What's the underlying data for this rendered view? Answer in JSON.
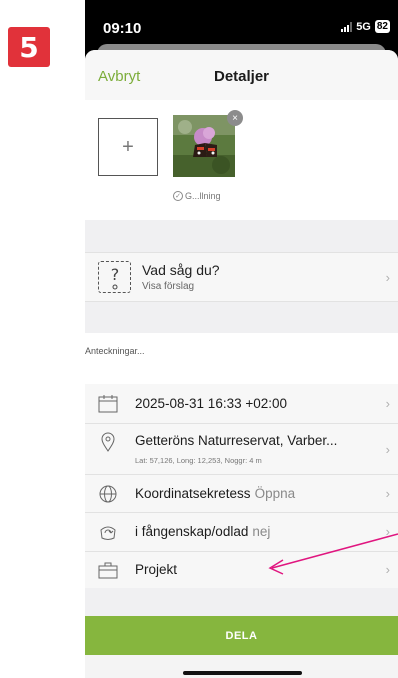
{
  "step_badge": "5",
  "status": {
    "time": "09:10",
    "network": "5G",
    "battery": "82"
  },
  "nav": {
    "cancel_label": "Avbryt",
    "title": "Detaljer"
  },
  "photos": {
    "add_label": "+",
    "remove_label": "×",
    "caption": "G...llning"
  },
  "species": {
    "icon_text": "?",
    "prompt": "Vad såg du?",
    "suggestion": "Visa förslag"
  },
  "notes": {
    "placeholder": "Anteckningar..."
  },
  "details": {
    "datetime": "2025-08-31 16:33 +02:00",
    "location": "Getteröns Naturreservat, Varber...",
    "coords": "Lat: 57,126, Long: 12,253, Noggr: 4 m",
    "privacy_label": "Koordinatsekretess",
    "privacy_value": "Öppna",
    "captive_label": "i fångenskap/odlad",
    "captive_value": "nej",
    "project_label": "Projekt"
  },
  "actions": {
    "share_label": "DELA"
  },
  "colors": {
    "accent_green": "#86b63e",
    "badge_red": "#e1323a",
    "arrow_magenta": "#e0157f"
  }
}
